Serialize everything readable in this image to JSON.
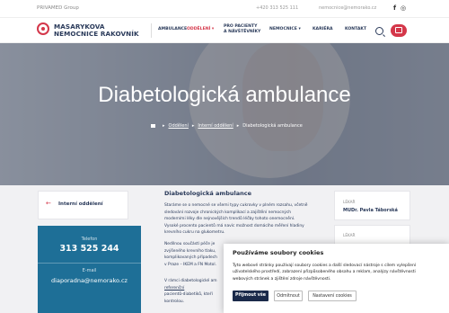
{
  "topbar": {
    "group_label": "PRIVAMED Group",
    "phone": "+420 313 525 111",
    "email": "nemocnice@nemorako.cz",
    "social": [
      "f",
      "◎"
    ]
  },
  "header": {
    "logo_line1": "MASARYKOVA",
    "logo_line2": "NEMOCNICE RAKOVNÍK",
    "nav": [
      {
        "label": "AMBULANCE"
      },
      {
        "label": "ODDĚLENÍ ▾"
      },
      {
        "label1": "PRO PACIENTY",
        "label2": "A NÁVŠTĚVNÍKY"
      },
      {
        "label": "NEMOCNICE ▾"
      },
      {
        "label": "KARIÉRA"
      },
      {
        "label": "KONTAKT"
      }
    ]
  },
  "hero": {
    "title": "Diabetologická ambulance",
    "breadcrumb": [
      "Oddělení",
      "Interní oddělení",
      "Diabetologická ambulance"
    ]
  },
  "sidebar": {
    "back_label": "Interní oddělení",
    "phone_label": "Telefon",
    "phone_value": "313 525 244",
    "email_label": "E-mail",
    "email_value": "diaporadna@nemorako.cz"
  },
  "main": {
    "title": "Diabetologická ambulance",
    "para1": [
      "Staráme se o nemocné se všemi typy cukrovky v plném rozsahu, včetně",
      "sledování rozvoje chronických komplikací a zajištění nemocných",
      "moderními léky dle nejnovějších trendů léčby tohoto onemocnění.",
      "Vysoké procento pacientů má navíc možnost domácího měření hladiny",
      "krevního cukru na glukometru."
    ],
    "para2": [
      "Nedílnou součástí péče je",
      "zvýšeného krevního tlaku,",
      "komplikovaných případech",
      "v Praze – IKEM a FN Motol."
    ],
    "para3_start": "V rámci diabetologické am",
    "para3_link": "referenční",
    "para3_rest": [
      "pacientů-diabetiků, kteří",
      "kontrolou."
    ]
  },
  "doctors": {
    "label": "LÉKAŘ",
    "name": "MUDr. Pavla Táborská",
    "label2": "LÉKAŘ"
  },
  "cookie": {
    "title": "Používáme soubory cookies",
    "text": [
      "Tyto webové stránky používají soubory cookies a další sledovací nástroje s cílem vylepšení",
      "uživatelského prostředí, zobrazení přizpůsobeného obsahu a reklam, analýzy návštěvnosti",
      "webových stránek a zjištění zdroje návštěvnosti."
    ],
    "accept": "Přijmout vše",
    "reject": "Odmítnout",
    "settings": "Nastavení cookies"
  },
  "colors": {
    "accent": "#d4374a",
    "navy": "#2a3a5a",
    "blue": "#1e6f97"
  }
}
